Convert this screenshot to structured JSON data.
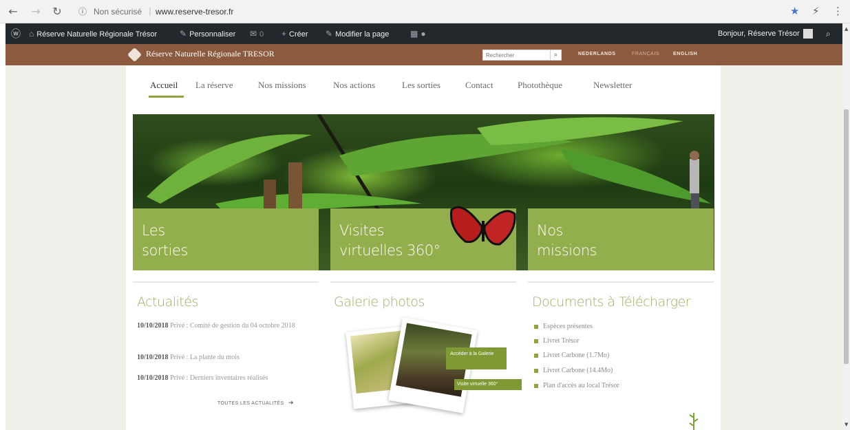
{
  "browser": {
    "security_label": "Non sécurisé",
    "separator": "|",
    "url": "www.reserve-tresor.fr",
    "icons": [
      "back-arrow-icon",
      "forward-arrow-icon",
      "reload-icon",
      "info-icon",
      "star-icon",
      "extension-icon",
      "menu-icon"
    ]
  },
  "adminbar": {
    "site_name": "Réserve Naturelle Régionale Trésor",
    "customize": "Personnaliser",
    "comments_count": "0",
    "create": "Créer",
    "edit_page": "Modifier la page",
    "greeting": "Bonjour, Réserve Trésor"
  },
  "header": {
    "site_title": "Réserve Naturelle Régionale TRESOR",
    "search_placeholder": "Rechercher",
    "languages": [
      "NEDERLANDS",
      "FRANÇAIS",
      "ENGLISH"
    ],
    "colors": {
      "header_bg": "#8c5a3f",
      "accent_green": "#93ae4c"
    }
  },
  "nav": {
    "items": [
      "Accueil",
      "La réserve",
      "Nos missions",
      "Nos actions",
      "Les sorties",
      "Contact",
      "Photothèque",
      "Newsletter"
    ],
    "active": "Accueil"
  },
  "hero_tiles": [
    {
      "line1": "Les",
      "line2": "sorties"
    },
    {
      "line1": "Visites",
      "line2": "virtuelles 360°"
    },
    {
      "line1": "Nos",
      "line2": "missions"
    }
  ],
  "news": {
    "title": "Actualités",
    "items": [
      {
        "date": "10/10/2018",
        "text": "Privé : Comité de gestion du 04 octobre 2018"
      },
      {
        "date": "10/10/2018",
        "text": "Privé : La plante du mois"
      },
      {
        "date": "10/10/2018",
        "text": "Privé : Derniers inventaires réalisés"
      }
    ],
    "all_link": "TOUTES LES ACTUALITÉS"
  },
  "gallery": {
    "title": "Galerie photos",
    "btn_gallery": "Accéder à la Galerie",
    "btn_virtual": "Visite virtuelle 360°"
  },
  "documents": {
    "title": "Documents à Télécharger",
    "items": [
      "Espèces présentes",
      "Livret Trésor",
      "Livret Carbone (1.7Mo)",
      "Livret Carbone (14.4Mo)",
      "Plan d'accès au local Trésor"
    ]
  }
}
